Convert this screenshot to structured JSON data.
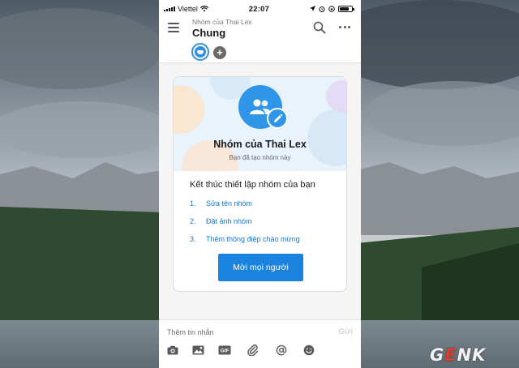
{
  "status_bar": {
    "carrier": "Viettel",
    "time": "22:07"
  },
  "header": {
    "group_subtitle": "Nhóm của Thai Lex",
    "group_title": "Chung"
  },
  "card": {
    "group_name": "Nhóm của Thai Lex",
    "created_note": "Bạn đã tạo nhóm này",
    "setup_title": "Kết thúc thiết lập nhóm của bạn",
    "steps": [
      {
        "num": "1.",
        "label": "Sửa tên nhóm"
      },
      {
        "num": "2.",
        "label": "Đặt ảnh nhóm"
      },
      {
        "num": "3.",
        "label": "Thêm thông điệp chào mừng"
      }
    ],
    "invite_button": "Mời mọi người"
  },
  "composer": {
    "placeholder": "Thêm tin nhắn",
    "send_label": "Gửi",
    "tools": [
      "camera-icon",
      "photo-icon",
      "gif-icon",
      "attachment-icon",
      "mention-icon",
      "emoji-icon"
    ],
    "gif_text": "GIF"
  },
  "watermark": {
    "g": "G",
    "e": "E",
    "nk": "NK"
  },
  "colors": {
    "accent": "#1a83e0",
    "link": "#1877d2",
    "hero_bg": "#e9f3fb"
  }
}
